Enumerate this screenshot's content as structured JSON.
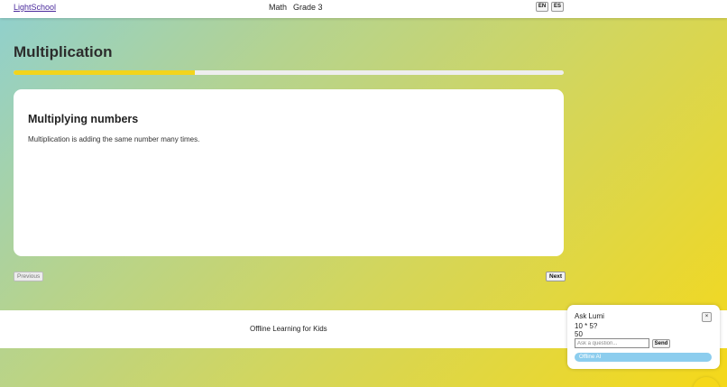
{
  "header": {
    "brand": "LightSchool",
    "subject": "Math",
    "grade": "Grade 3",
    "languages": [
      "EN",
      "ES"
    ]
  },
  "lesson": {
    "title": "Multiplication",
    "progress_percent": 33,
    "card": {
      "title": "Multiplying numbers",
      "body": "Multiplication is adding the same number many times."
    },
    "prev_label": "Previous",
    "next_label": "Next"
  },
  "footer": {
    "text": "Offline Learning for Kids"
  },
  "assistant": {
    "title": "Ask Lumi",
    "close_label": "×",
    "last_question": "10 * 5?",
    "last_answer": "50",
    "input_value": "",
    "input_placeholder": "Ask a question...",
    "send_label": "Send",
    "mode_badge": "Offline AI"
  },
  "colors": {
    "accent": "#f2d41c",
    "badge": "#8ccdee",
    "link": "#4a2a9c"
  }
}
